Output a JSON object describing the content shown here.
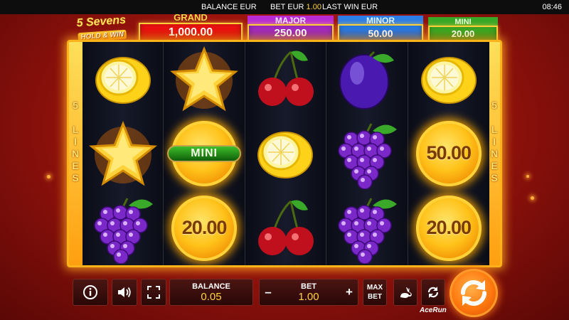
{
  "status_bar": {
    "balance_label": "BALANCE EUR",
    "bet_label": "BET EUR",
    "bet_value": "1.00",
    "last_win_label": "LAST WIN EUR",
    "clock": "08:46"
  },
  "logo": {
    "line1": "5 Sevens",
    "line2": "HOLD & WIN"
  },
  "jackpots": {
    "grand": {
      "label": "GRAND",
      "value": "1,000.00"
    },
    "major": {
      "label": "MAJOR",
      "value": "250.00"
    },
    "minor": {
      "label": "MINOR",
      "value": "50.00"
    },
    "mini": {
      "label": "MINI",
      "value": "20.00"
    }
  },
  "side_labels": {
    "left": "5 LINES",
    "right": "5 LINES"
  },
  "reels": [
    {
      "symbols": [
        {
          "type": "lemon"
        },
        {
          "type": "star"
        },
        {
          "type": "grapes"
        }
      ]
    },
    {
      "symbols": [
        {
          "type": "star"
        },
        {
          "type": "coin",
          "badge": "MINI"
        },
        {
          "type": "coin",
          "value": "20.00"
        }
      ]
    },
    {
      "symbols": [
        {
          "type": "cherry"
        },
        {
          "type": "lemon"
        },
        {
          "type": "cherry"
        }
      ]
    },
    {
      "symbols": [
        {
          "type": "plum"
        },
        {
          "type": "grapes"
        },
        {
          "type": "grapes"
        }
      ]
    },
    {
      "symbols": [
        {
          "type": "lemon"
        },
        {
          "type": "coin",
          "value": "50.00"
        },
        {
          "type": "coin",
          "value": "20.00"
        }
      ]
    }
  ],
  "controls": {
    "info_icon": "info-icon",
    "sound_icon": "speaker-icon",
    "fullscreen_icon": "fullscreen-icon",
    "balance": {
      "label": "BALANCE",
      "value": "0.05"
    },
    "bet": {
      "label": "BET",
      "value": "1.00",
      "minus": "–",
      "plus": "+"
    },
    "max_bet": "MAX BET",
    "turbo_icon": "rabbit-icon",
    "autoplay_icon": "autoplay-icon",
    "spin_icon": "spin-arrows-icon"
  },
  "brand": "AceRun",
  "colors": {
    "grand": "#d40000",
    "major": "#8a1bb5",
    "minor": "#1e5fd0",
    "mini": "#2a8f1c",
    "accent": "#ffd33c",
    "spin": "#ff7a10"
  }
}
